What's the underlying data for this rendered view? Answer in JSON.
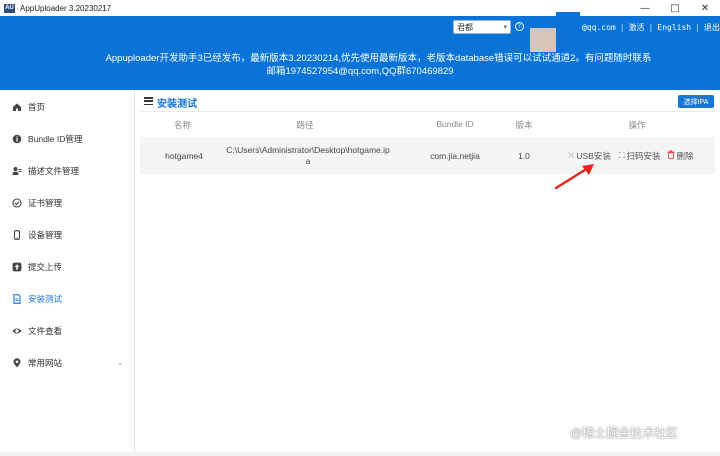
{
  "window": {
    "title": "AppUploader 3.20230217",
    "icon_text": "AU",
    "controls": [
      "—",
      "□",
      "✕"
    ]
  },
  "header": {
    "theme_select": "君都",
    "email": "@qq.com",
    "links": [
      "激活",
      "English",
      "退出"
    ],
    "announcement_line1": "Appuploader开发助手3已经发布，最新版本3.20230214,优先使用最新版本，老版本database错误可以试试通道2。有问题随时联系",
    "announcement_line2": "邮箱1974527954@qq.com,QQ群670469829",
    "colors": {
      "header_bg": "#0a73d8",
      "accent": "#1677d8"
    }
  },
  "sidebar": {
    "items": [
      {
        "label": "首页",
        "icon": "home-icon"
      },
      {
        "label": "Bundle ID管理",
        "icon": "info-icon"
      },
      {
        "label": "描述文件管理",
        "icon": "profile-icon"
      },
      {
        "label": "证书管理",
        "icon": "certificate-icon"
      },
      {
        "label": "设备管理",
        "icon": "phone-icon"
      },
      {
        "label": "提交上传",
        "icon": "upload-icon"
      },
      {
        "label": "安装测试",
        "icon": "file-icon",
        "active": true
      },
      {
        "label": "文件查看",
        "icon": "eye-icon"
      },
      {
        "label": "常用网站",
        "icon": "location-icon"
      }
    ]
  },
  "main": {
    "title": "安装测试",
    "select_ipa_label": "选择IPA",
    "columns": [
      "名称",
      "路径",
      "Bundle ID",
      "版本",
      "操作"
    ],
    "rows": [
      {
        "name": "hotgame4",
        "path_line1": "C:\\Users\\Administrator\\Desktop\\hotgame.ip",
        "path_line2": "a",
        "bundle_id": "com.jia.netjia",
        "version": "1.0",
        "actions": [
          "USB安装",
          "扫码安装",
          "删除"
        ]
      }
    ]
  },
  "watermark": "@稀土掘金技术社区"
}
